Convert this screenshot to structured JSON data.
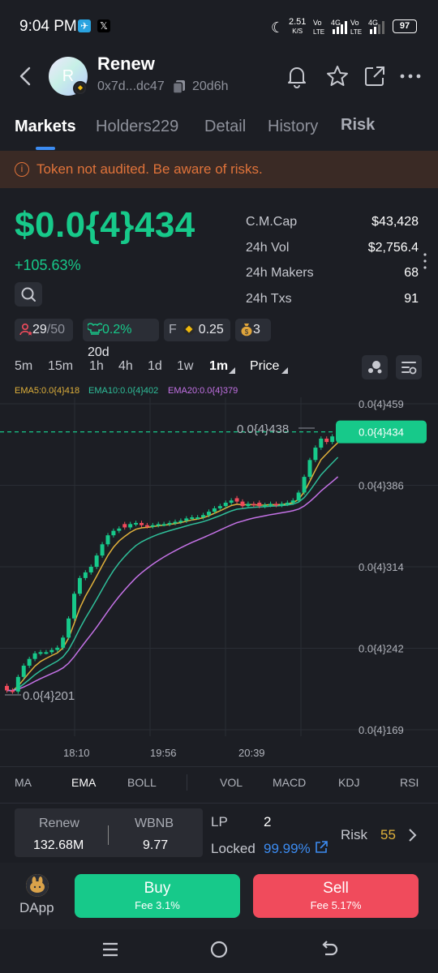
{
  "status_bar": {
    "time": "9:04 PM",
    "net_speed": "2.51",
    "net_unit": "K/S",
    "battery": "97"
  },
  "token": {
    "avatar_letter": "R",
    "name": "Renew",
    "address": "0x7d...dc47",
    "age": "20d6h"
  },
  "tabs": [
    "Markets",
    "Holders229",
    "Detail",
    "History",
    "Risk"
  ],
  "warning": "Token not audited. Be aware of risks.",
  "price": {
    "value": "$0.0{4}434",
    "change": "+105.63%"
  },
  "stats": [
    {
      "label": "C.M.Cap",
      "value": "$43,428"
    },
    {
      "label": "24h Vol",
      "value": "$2,756.4"
    },
    {
      "label": "24h Makers",
      "value": "68"
    },
    {
      "label": "24h Txs",
      "value": "91"
    }
  ],
  "chips": {
    "holders": "29",
    "holders_total": "/50",
    "dev_pct": "0.2%",
    "dev_age": "20d",
    "f_label": "F",
    "f_value": "0.25",
    "bags": "3"
  },
  "timeframes": [
    "5m",
    "15m",
    "1h",
    "4h",
    "1d",
    "1w",
    "1m",
    "Price"
  ],
  "active_timeframe": "1m",
  "ema_legend": [
    {
      "text": "EMA5:0.0{4}418",
      "color": "#e0b13b"
    },
    {
      "text": "EMA10:0.0{4}402",
      "color": "#2fbf9a"
    },
    {
      "text": "EMA20:0.0{4}379",
      "color": "#c472e6"
    }
  ],
  "chart_data": {
    "type": "candlestick",
    "y_axis_labels": [
      "0.0{4}459",
      "0.0{4}386",
      "0.0{4}314",
      "0.0{4}242",
      "0.0{4}169"
    ],
    "x_axis_labels": [
      "18:10",
      "19:56",
      "20:39"
    ],
    "max_marker": "0.0{4}438",
    "min_marker": "0.0{4}201",
    "last_price_tag": "0.0{4}434",
    "candles_close_sequence": [
      0.204,
      0.203,
      0.216,
      0.226,
      0.232,
      0.237,
      0.238,
      0.238,
      0.24,
      0.242,
      0.251,
      0.268,
      0.29,
      0.304,
      0.309,
      0.314,
      0.324,
      0.334,
      0.342,
      0.346,
      0.348,
      0.349,
      0.352,
      0.353,
      0.351,
      0.35,
      0.351,
      0.352,
      0.352,
      0.353,
      0.354,
      0.355,
      0.357,
      0.358,
      0.358,
      0.36,
      0.363,
      0.366,
      0.368,
      0.371,
      0.373,
      0.372,
      0.368,
      0.37,
      0.369,
      0.368,
      0.369,
      0.37,
      0.369,
      0.37,
      0.371,
      0.373,
      0.38,
      0.394,
      0.409,
      0.42,
      0.428,
      0.425,
      0.43,
      0.434
    ]
  },
  "indicators": [
    "MA",
    "EMA",
    "BOLL",
    "VOL",
    "MACD",
    "KDJ",
    "RSI"
  ],
  "active_indicator": "EMA",
  "pool": {
    "token_a": "Renew",
    "amount_a": "132.68M",
    "token_b": "WBNB",
    "amount_b": "9.77",
    "lp_label": "LP",
    "lp_value": "2",
    "locked_label": "Locked",
    "locked_value": "99.99%",
    "risk_label": "Risk",
    "risk_value": "55"
  },
  "actions": {
    "dapp": "DApp",
    "buy": "Buy",
    "buy_fee": "Fee 3.1%",
    "sell": "Sell",
    "sell_fee": "Fee 5.17%"
  },
  "colors": {
    "up": "#17c98a",
    "down": "#f04b5c",
    "accent": "#3c8cf2",
    "warning": "#e0733a"
  }
}
